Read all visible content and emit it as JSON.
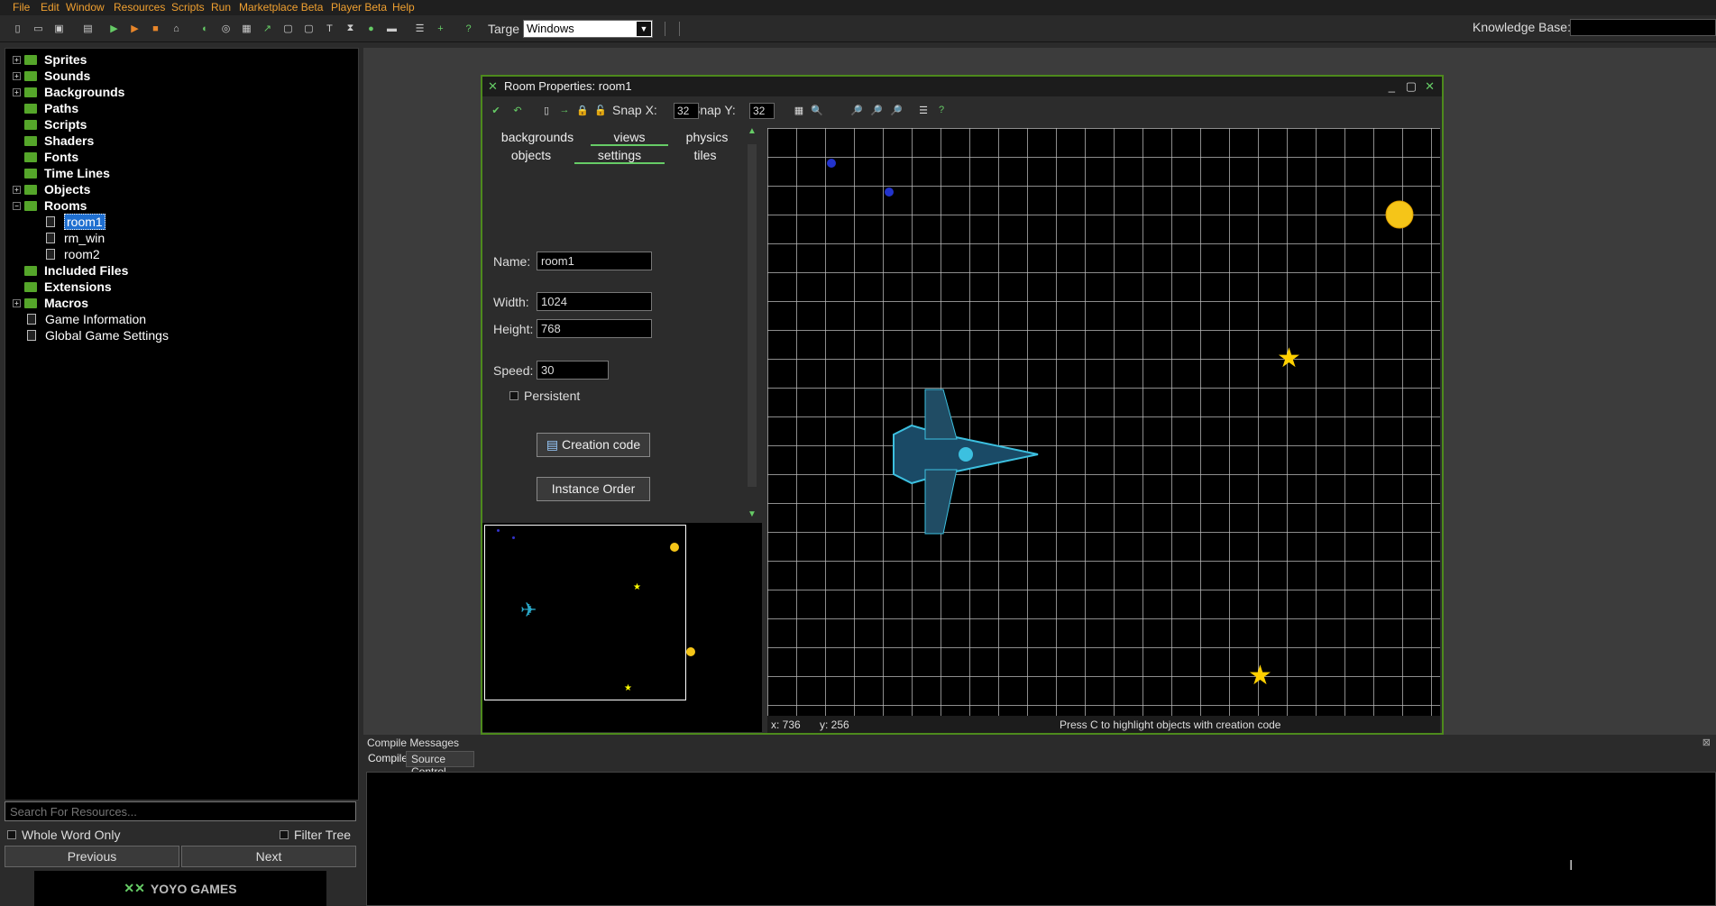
{
  "menu": [
    "File",
    "Edit",
    "Window",
    "Resources",
    "Scripts",
    "Run",
    "Marketplace Beta",
    "Player Beta",
    "Help"
  ],
  "toolbar": {
    "target_label": "Targe",
    "target_value": "Windows",
    "kb_label": "Knowledge Base:"
  },
  "tree": {
    "items": [
      "Sprites",
      "Sounds",
      "Backgrounds",
      "Paths",
      "Scripts",
      "Shaders",
      "Fonts",
      "Time Lines",
      "Objects",
      "Rooms"
    ],
    "rooms": [
      "room1",
      "rm_win",
      "room2"
    ],
    "after": [
      "Included Files",
      "Extensions",
      "Macros"
    ],
    "plain": [
      "Game Information",
      "Global Game Settings"
    ]
  },
  "search_placeholder": "Search For Resources...",
  "whole_word": "Whole Word Only",
  "filter_tree": "Filter Tree",
  "prev": "Previous",
  "next": "Next",
  "logo": "YOYO GAMES",
  "room": {
    "title": "Room Properties: room1",
    "snapx_label": "Snap X:",
    "snapx": "32",
    "snapy_label": "Snap Y:",
    "snapy": "32",
    "tabs": [
      "backgrounds",
      "views",
      "physics",
      "objects",
      "settings",
      "tiles"
    ],
    "name_label": "Name:",
    "name": "room1",
    "width_label": "Width:",
    "width": "1024",
    "height_label": "Height:",
    "height": "768",
    "speed_label": "Speed:",
    "speed": "30",
    "persistent": "Persistent",
    "creation_code": "Creation code",
    "instance_order": "Instance Order",
    "status_x": "x: 736",
    "status_y": "y: 256",
    "status_msg": "Press C to highlight objects with creation code"
  },
  "compile": {
    "title": "Compile Messages",
    "tab1": "Compile",
    "tab2": "Source Control"
  }
}
